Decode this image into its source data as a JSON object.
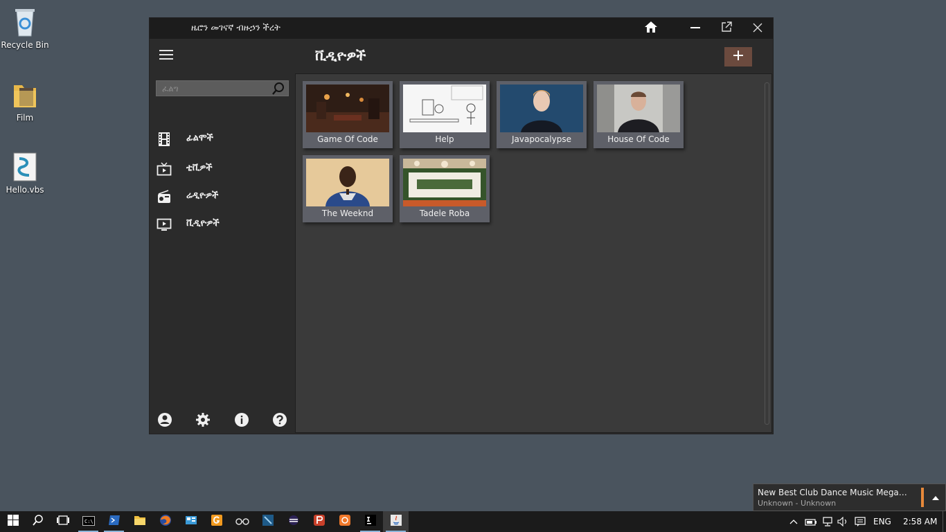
{
  "desktop": {
    "icons": [
      {
        "label": "Recycle Bin",
        "icon": "recycle-bin-icon"
      },
      {
        "label": "Film",
        "icon": "folder-icon"
      },
      {
        "label": "Hello.vbs",
        "icon": "script-file-icon"
      }
    ]
  },
  "window": {
    "title": "ዜሮን መገናኛ ብዙኃን ችረት",
    "controls": [
      "home-icon",
      "minimize-icon",
      "popout-icon",
      "close-icon"
    ]
  },
  "sidebar": {
    "search_placeholder": "ፈልግ",
    "items": [
      {
        "label": "ፊልሞች",
        "icon": "film-icon"
      },
      {
        "label": "ቲቪዎች",
        "icon": "tv-icon"
      },
      {
        "label": "ሬዲዮዎች",
        "icon": "radio-icon"
      },
      {
        "label": "ቪዲዮዎች",
        "icon": "video-icon"
      }
    ],
    "bottom_icons": [
      "account-icon",
      "settings-icon",
      "info-icon",
      "help-icon"
    ]
  },
  "main": {
    "title": "ቪዲዮዎች",
    "add_label": "+",
    "videos": [
      {
        "title": "Game Of Code"
      },
      {
        "title": "Help"
      },
      {
        "title": "Javapocalypse"
      },
      {
        "title": "House Of Code"
      },
      {
        "title": "The Weeknd"
      },
      {
        "title": "Tadele Roba"
      }
    ]
  },
  "notification": {
    "title": "New Best Club Dance Music Megamix 2...",
    "subtitle": "Unknown - Unknown"
  },
  "taskbar": {
    "language": "ENG",
    "time": "2:58 AM"
  },
  "colors": {
    "desktop": "#4a545e",
    "window_bg": "#2b2b2b",
    "titlebar": "#1c1c1c",
    "content_bg": "#3a3a3a",
    "add_button": "#6b4a3e",
    "accent_orange": "#e7893a"
  }
}
